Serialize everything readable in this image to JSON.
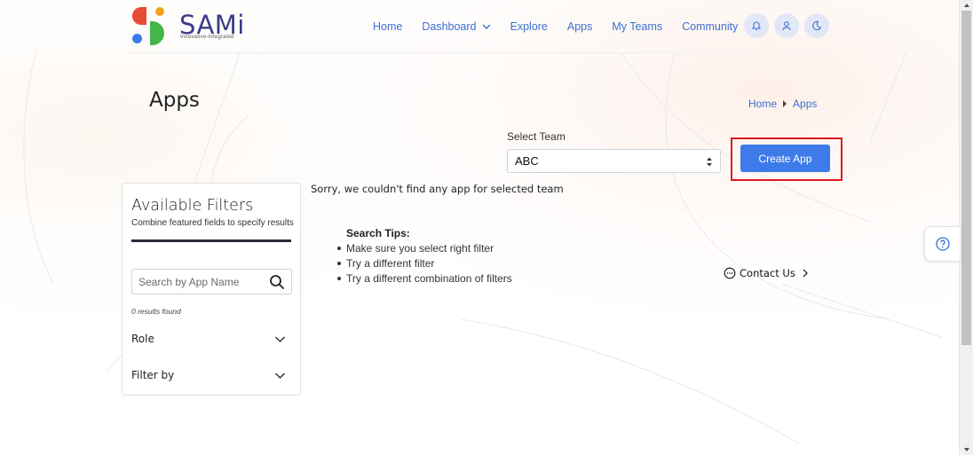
{
  "brand": {
    "name": "SAMi",
    "tagline": "Innovative-Integrated",
    "colors": {
      "red": "#e94b35",
      "orange": "#f4a21b",
      "blue": "#3d7bea",
      "green": "#43b649",
      "word": "#3d3a8c"
    }
  },
  "nav": {
    "items": [
      {
        "label": "Home"
      },
      {
        "label": "Dashboard",
        "dropdown": true
      },
      {
        "label": "Explore"
      },
      {
        "label": "Apps"
      },
      {
        "label": "My Teams"
      },
      {
        "label": "Community",
        "dropdown": true
      }
    ],
    "icons": [
      "bell-icon",
      "user-icon",
      "moon-icon"
    ]
  },
  "page": {
    "title": "Apps",
    "breadcrumb": {
      "home": "Home",
      "current": "Apps"
    }
  },
  "team": {
    "label": "Select Team",
    "selected": "ABC"
  },
  "actions": {
    "create_app": "Create App",
    "accent": "#3d7bea",
    "highlight": "#e0181f"
  },
  "filters": {
    "title": "Available Filters",
    "subtitle": "Combine featured fields to specify results",
    "search_placeholder": "Search by App Name",
    "results": "0 results found",
    "sections": [
      {
        "label": "Role"
      },
      {
        "label": "Filter by"
      }
    ]
  },
  "empty": {
    "message": "Sorry, we couldn't find any app for selected team",
    "tips_title": "Search Tips:",
    "tips": [
      "Make sure you select right filter",
      "Try a different filter",
      "Try a different combination of filters"
    ]
  },
  "contact": {
    "label": "Contact Us"
  }
}
